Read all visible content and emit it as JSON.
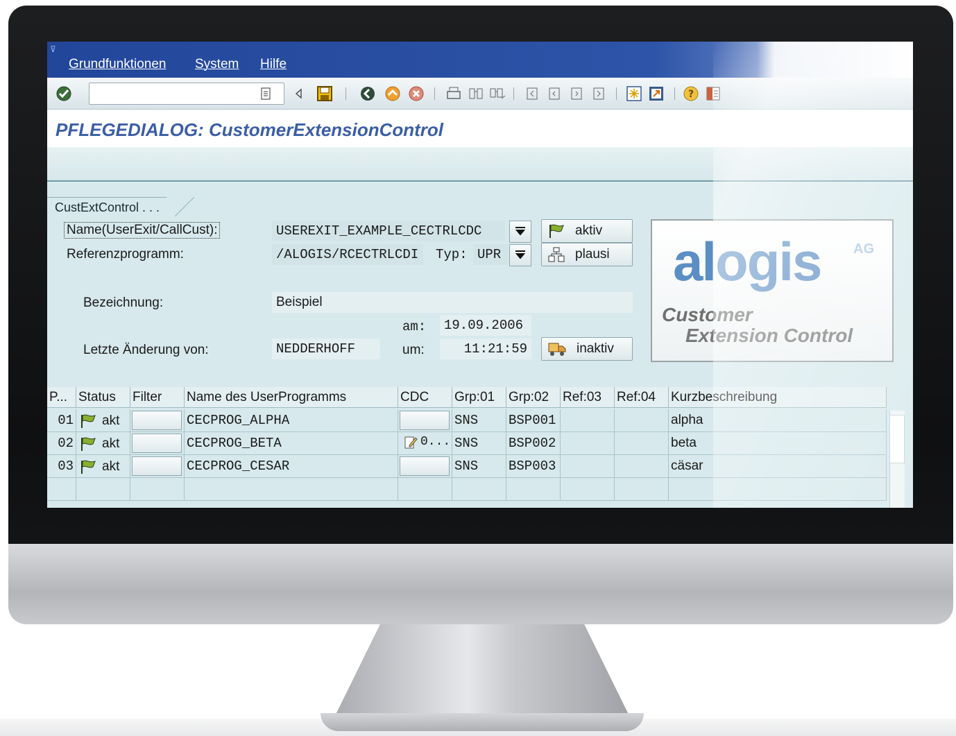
{
  "menu": {
    "items": [
      {
        "label": "Grundfunktionen"
      },
      {
        "label": "System"
      },
      {
        "label": "Hilfe"
      }
    ]
  },
  "toolbar": {
    "command_value": "",
    "icons": [
      "enter-check-icon",
      "command-dropdown-icon",
      "nav-left-icon",
      "save-icon",
      "back-icon",
      "exit-icon",
      "cancel-icon",
      "print-icon",
      "find-icon",
      "find-next-icon",
      "first-page-icon",
      "previous-page-icon",
      "next-page-icon",
      "last-page-icon",
      "new-session-icon",
      "shortcut-icon",
      "help-icon",
      "layout-icon"
    ]
  },
  "title": "PFLEGEDIALOG: CustomerExtensionControl",
  "group_tab": "CustExtControl . . .",
  "form": {
    "name_label": "Name(UserExit/CallCust):",
    "name_value": "USEREXIT_EXAMPLE_CECTRLCDC",
    "aktiv_label": "aktiv",
    "ref_label": "Referenzprogramm:",
    "ref_value": "/ALOGIS/RCECTRLCDI",
    "typ_label": "Typ:",
    "typ_value": "UPR",
    "plausi_label": "plausi",
    "bez_label": "Bezeichnung:",
    "bez_value": "Beispiel",
    "am_label": "am:",
    "am_value": "19.09.2006",
    "change_label": "Letzte Änderung von:",
    "change_value": "NEDDERHOFF",
    "um_label": "um:",
    "um_value": "11:21:59",
    "inaktiv_label": "inaktiv"
  },
  "logo": {
    "word": "alogis",
    "suffix": "AG",
    "tagline_1": "Customer",
    "tagline_2": "Extension Control"
  },
  "table": {
    "columns": [
      "P...",
      "Status",
      "Filter",
      "Name des UserProgramms",
      "CDC",
      "Grp:01",
      "Grp:02",
      "Ref:03",
      "Ref:04",
      "Kurzbeschreibung"
    ],
    "rows": [
      {
        "p": "01",
        "status": "akt",
        "filter": "",
        "name": "CECPROG_ALPHA",
        "cdc": "",
        "grp01": "SNS",
        "grp02": "BSP001",
        "ref03": "",
        "ref04": "",
        "desc": "alpha"
      },
      {
        "p": "02",
        "status": "akt",
        "filter": "",
        "name": "CECPROG_BETA",
        "cdc": "0...",
        "grp01": "SNS",
        "grp02": "BSP002",
        "ref03": "",
        "ref04": "",
        "desc": "beta"
      },
      {
        "p": "03",
        "status": "akt",
        "filter": "",
        "name": "CECPROG_CESAR",
        "cdc": "",
        "grp01": "SNS",
        "grp02": "BSP003",
        "ref03": "",
        "ref04": "",
        "desc": "cäsar"
      }
    ]
  },
  "colors": {
    "menubar": "#2d54a8",
    "title": "#3b5ea6",
    "content_bg": "#d7e9ec",
    "logo_blue": "#5b8ec4"
  }
}
